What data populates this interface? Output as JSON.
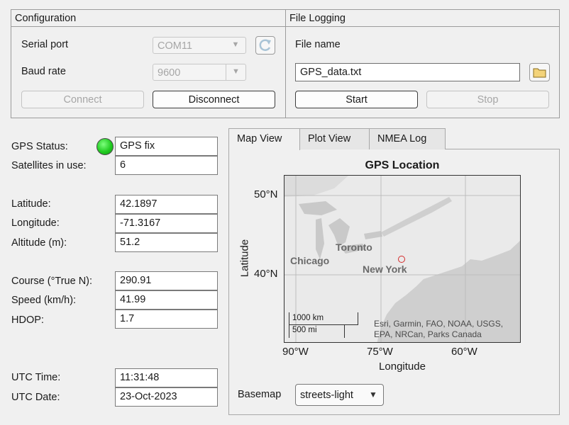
{
  "configuration": {
    "title": "Configuration",
    "serial_port_label": "Serial port",
    "serial_port_value": "COM11",
    "baud_rate_label": "Baud rate",
    "baud_rate_value": "9600",
    "connect_label": "Connect",
    "disconnect_label": "Disconnect"
  },
  "file_logging": {
    "title": "File Logging",
    "file_name_label": "File name",
    "file_name_value": "GPS_data.txt",
    "start_label": "Start",
    "stop_label": "Stop"
  },
  "status": {
    "gps_status_label": "GPS Status:",
    "gps_status_value": "GPS fix",
    "gps_lamp_color": "#22cc22",
    "satellites_label": "Satellites in use:",
    "satellites_value": "6",
    "latitude_label": "Latitude:",
    "latitude_value": "42.1897",
    "longitude_label": "Longitude:",
    "longitude_value": "-71.3167",
    "altitude_label": "Altitude (m):",
    "altitude_value": "51.2",
    "course_label": "Course (°True N):",
    "course_value": "290.91",
    "speed_label": "Speed (km/h):",
    "speed_value": "41.99",
    "hdop_label": "HDOP:",
    "hdop_value": "1.7",
    "utc_time_label": "UTC Time:",
    "utc_time_value": "11:31:48",
    "utc_date_label": "UTC Date:",
    "utc_date_value": "23-Oct-2023"
  },
  "tabs": [
    "Map View",
    "Plot View",
    "NMEA Log"
  ],
  "map": {
    "title": "GPS Location",
    "ylabel": "Latitude",
    "xlabel": "Longitude",
    "lat_ticks": [
      "50°N",
      "40°N"
    ],
    "lon_ticks": [
      "90°W",
      "75°W",
      "60°W"
    ],
    "city_chicago": "Chicago",
    "city_toronto": "Toronto",
    "city_newyork": "New York",
    "scale_km": "1000 km",
    "scale_mi": "500 mi",
    "attribution_line1": "Esri, Garmin, FAO, NOAA, USGS,",
    "attribution_line2": "EPA, NRCan, Parks Canada",
    "marker_lat": 42.1897,
    "marker_lon": -71.3167
  },
  "basemap": {
    "label": "Basemap",
    "value": "streets-light"
  }
}
